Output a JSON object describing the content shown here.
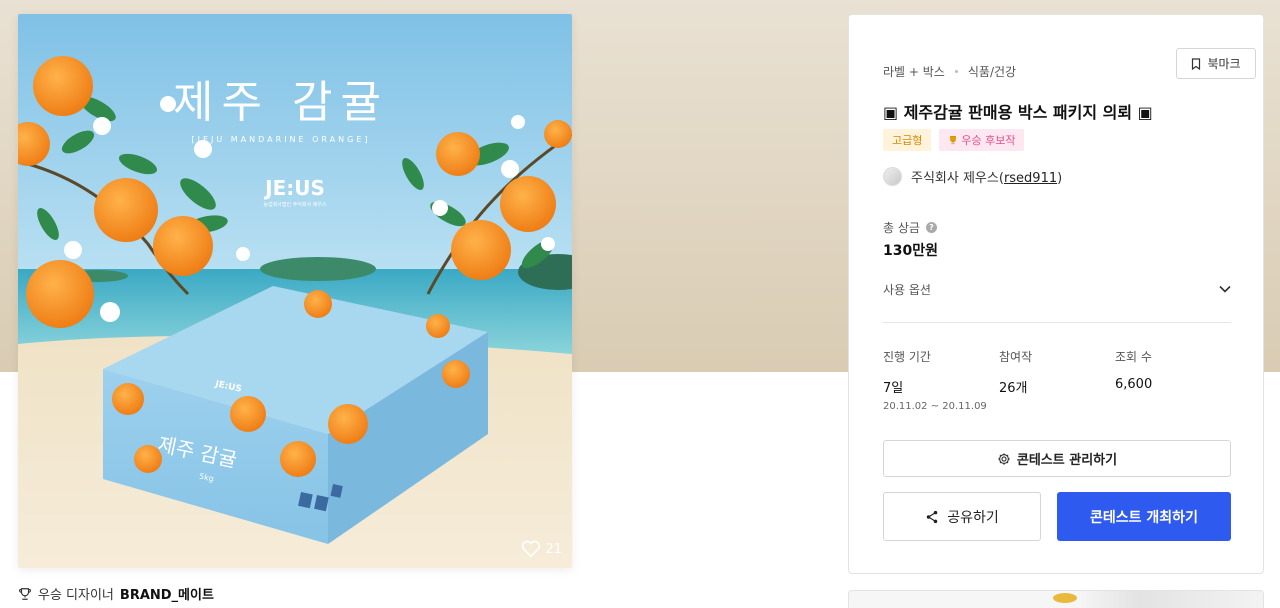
{
  "product": {
    "image_heading": "제주 감귤",
    "image_subheading": "[JEJU MANDARINE ORANGE]",
    "brand_logo": "JE:US",
    "brand_tagline": "농업회사법인 주식회사 제우스",
    "box_front_label": "제주 감귤",
    "box_weight": "5kg",
    "box_side_logo": "JE:US",
    "likes": "21"
  },
  "winner": {
    "prefix": "우승 디자이너",
    "name": "BRAND_메이트",
    "icon": "trophy-icon"
  },
  "contest": {
    "category_main": "라벨 + 박스",
    "category_sub": "식품/건강",
    "bookmark_label": "북마크",
    "title": "▣ 제주감귤 판매용 박스 패키지 의뢰 ▣",
    "badges": [
      "고급형",
      "우승 후보작"
    ],
    "host_prefix": "주식회사 제우스",
    "host_id": "rsed911",
    "prize_label": "총 상금",
    "prize_value": "130만원",
    "options_label": "사용 옵션",
    "stats": [
      {
        "label": "진행 기간",
        "value": "7일",
        "sub": "20.11.02 ~ 20.11.09"
      },
      {
        "label": "참여작",
        "value": "26개",
        "sub": ""
      },
      {
        "label": "조회 수",
        "value": "6,600",
        "sub": ""
      }
    ],
    "manage_label": "콘테스트 관리하기",
    "share_label": "공유하기",
    "host_contest_label": "콘테스트 개최하기"
  },
  "colors": {
    "primary": "#2f5af0",
    "premium_badge": "#d88a00",
    "winner_badge": "#e0508c"
  }
}
